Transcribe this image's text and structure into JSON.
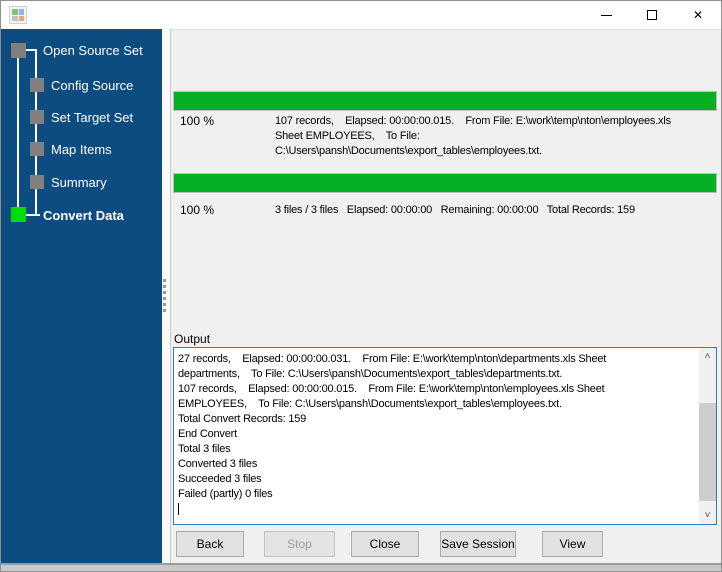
{
  "window": {
    "title": "",
    "icons": {
      "app_icon": "converter-grid",
      "minimize": "minimize-line",
      "maximize": "maximize-square",
      "close": "✕",
      "scroll_up": "˄",
      "scroll_down": "˅"
    }
  },
  "sidebar": {
    "steps": [
      {
        "label": "Open Source Set",
        "state": "done"
      },
      {
        "label": "Config Source",
        "state": "done"
      },
      {
        "label": "Set Target Set",
        "state": "done"
      },
      {
        "label": "Map Items",
        "state": "done"
      },
      {
        "label": "Summary",
        "state": "done"
      },
      {
        "label": "Convert Data",
        "state": "active"
      }
    ]
  },
  "file_progress": {
    "percent": 100,
    "percent_label": "100 %",
    "lines": [
      "107 records,    Elapsed: 00:00:00.015.    From File: E:\\work\\temp\\nton\\employees.xls",
      "Sheet EMPLOYEES,    To File:",
      "C:\\Users\\pansh\\Documents\\export_tables\\employees.txt."
    ]
  },
  "total_progress": {
    "percent": 100,
    "percent_label": "100 %",
    "summary": "3 files / 3 files   Elapsed: 00:00:00   Remaining: 00:00:00   Total Records: 159"
  },
  "output": {
    "label": "Output",
    "lines": [
      "27 records,    Elapsed: 00:00:00.031.    From File: E:\\work\\temp\\nton\\departments.xls Sheet",
      "departments,    To File: C:\\Users\\pansh\\Documents\\export_tables\\departments.txt.",
      "107 records,    Elapsed: 00:00:00.015.    From File: E:\\work\\temp\\nton\\employees.xls Sheet",
      "EMPLOYEES,    To File: C:\\Users\\pansh\\Documents\\export_tables\\employees.txt.",
      "Total Convert Records: 159",
      "End Convert",
      "Total 3 files",
      "Converted 3 files",
      "Succeeded 3 files",
      "Failed (partly) 0 files"
    ]
  },
  "buttons": [
    {
      "label": "Back",
      "enabled": true
    },
    {
      "label": "Stop",
      "enabled": false
    },
    {
      "label": "Close",
      "enabled": true
    },
    {
      "label": "Save Session",
      "enabled": true
    },
    {
      "label": "View",
      "enabled": true
    }
  ],
  "colors": {
    "sidebar_bg": "#0d4c80",
    "progress_green": "#06b025",
    "step_done_gray": "#808080",
    "step_active_green": "#00dd00",
    "output_border_blue": "#2e7cc1",
    "main_bg": "#f0f0f0"
  }
}
